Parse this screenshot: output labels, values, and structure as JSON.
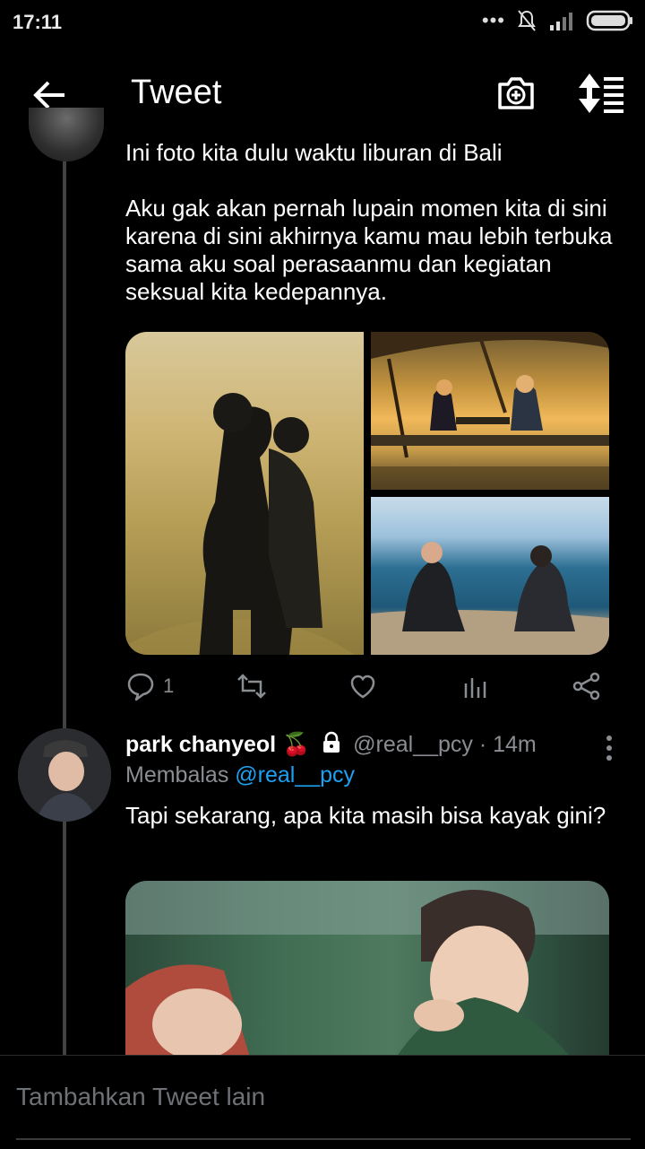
{
  "status_bar": {
    "time": "17:11"
  },
  "header": {
    "title": "Tweet"
  },
  "tweet1": {
    "paragraphs": [
      "Ini foto kita dulu waktu liburan di Bali",
      "Aku gak akan pernah lupain momen kita di sini karena di sini akhirnya kamu mau lebih terbuka sama aku soal perasaanmu dan kegiatan seksual kita kedepannya."
    ],
    "reply_count": "1"
  },
  "tweet2": {
    "name": "park chanyeol 🍒",
    "handle": "@real__pcy",
    "time": "· 14m",
    "reply_prefix": "Membalas",
    "reply_to": "@real__pcy",
    "text": "Tapi sekarang, apa kita masih bisa kayak gini?"
  },
  "composer": {
    "placeholder": "Tambahkan Tweet lain"
  },
  "colors": {
    "accent": "#1da1f2",
    "muted": "#8a8d91",
    "background": "#000000"
  }
}
